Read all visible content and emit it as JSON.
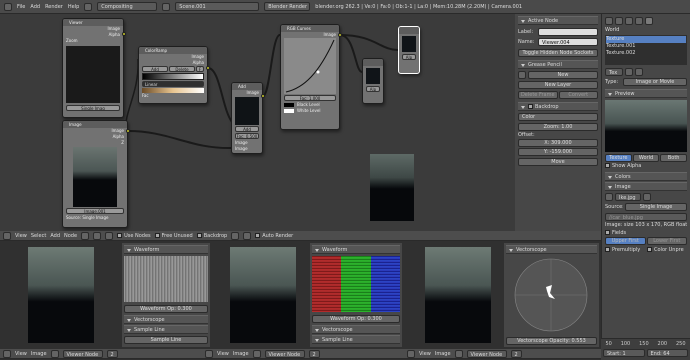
{
  "topbar": {
    "info_icon": "info-icon",
    "menus": [
      "File",
      "Add",
      "Render",
      "Help"
    ],
    "screen": "Compositing",
    "scene": "Scene.001",
    "engine": "Blender Render",
    "status": "blender.org 262.3 | Ve:0 | Fa:0 | Ob:1-1 | La:0 | Mem:10.28M (2.20M) | Camera.001"
  },
  "nodes": {
    "viewer": {
      "title": "Viewer",
      "image": "Image",
      "alpha": "Alpha",
      "zoom": "Zoom",
      "single": "Single Imag"
    },
    "colorramp": {
      "title": "ColorRamp",
      "image": "Image",
      "alpha": "Alpha",
      "add": "Add",
      "delete": "Delete",
      "f": "F",
      "mode": "Linear",
      "fac": "Fac"
    },
    "mix": {
      "title": "Add",
      "image": "Image",
      "add": "Add",
      "fac": "Fac: 0.500",
      "img1": "Image",
      "img2": "Image"
    },
    "rgb": {
      "title": "RGB Curves",
      "image": "Image",
      "fac": "Fac: 1.000",
      "black": "Black Level",
      "white": "White Level"
    },
    "image": {
      "title": "Image",
      "image": "Image",
      "alpha": "Alpha",
      "z": "Z",
      "file": "Image.001",
      "source_label": "Source:",
      "source": "Single Image"
    },
    "viewer2": {
      "field": "Viewer 004"
    },
    "sep": {
      "field": "Alp"
    }
  },
  "npanel": {
    "active_node": "Active Node",
    "label_label": "Label:",
    "name_label": "Name:",
    "name_value": "Viewer.004",
    "toggle": "Toggle Hidden Node Sockets",
    "grease": "Grease Pencil",
    "new": "New",
    "new_layer": "New Layer",
    "delete_frame": "Delete Frame",
    "convert": "Convert",
    "backdrop": "Backdrop",
    "color": "Color",
    "zoom": "Zoom: 1.00",
    "offset": "Offset:",
    "x": "X: 309.000",
    "yval": "Y: -159.000",
    "move": "Move"
  },
  "props": {
    "world": "World",
    "textures": [
      "Texture",
      "Texture.001",
      "Texture.002"
    ],
    "tex_name": "Tex",
    "type_label": "Type:",
    "type_value": "Image or Movie",
    "preview": "Preview",
    "tabs": [
      "Texture",
      "World",
      "Both"
    ],
    "show_alpha": "Show Alpha",
    "colors": "Colors",
    "image": "Image",
    "img_name": "Ike.jpg",
    "source_label": "Source:",
    "source": "Single Image",
    "path": "//car_blue.jpg",
    "info": "Image: size 103 x 170, RGB float",
    "fields": "Fields",
    "upper": "Upper First",
    "lower": "Lower First",
    "premultiply": "Premultiply",
    "color_unpre": "Color Unpre",
    "ruler": [
      "50",
      "100",
      "150",
      "200",
      "250"
    ],
    "frame_label": "Start:",
    "frame": "Start: 1",
    "end": "End: 64"
  },
  "bottom": {
    "menus": [
      "View",
      "Select",
      "Add",
      "Node"
    ],
    "use_nodes": "Use Nodes",
    "free_unused": "Free Unused",
    "backdrop": "Backdrop",
    "auto_render": "Auto Render",
    "footer_menus": [
      "View",
      "Image"
    ],
    "viewer_node": "Viewer Node",
    "slot": "2",
    "waveform": "Waveform",
    "waveform_op": "Waveform Op: 0.300",
    "vectorscope": "Vectorscope",
    "sample_line": "Sample Line",
    "sample_btn": "Sample Line",
    "vectorscope_op": "Vectorscope Opacity: 0.553"
  }
}
